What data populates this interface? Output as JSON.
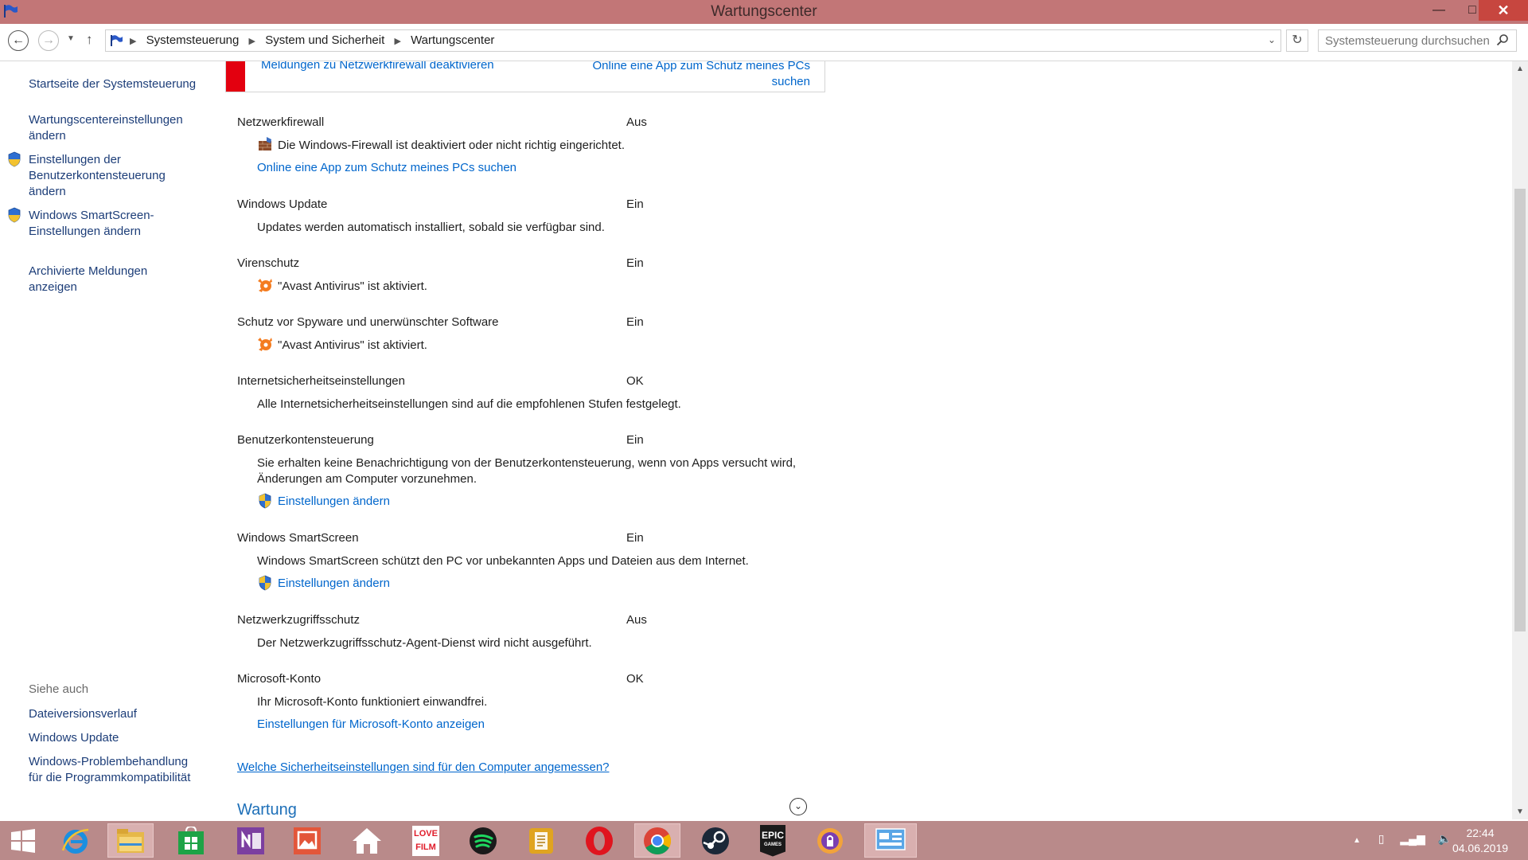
{
  "window": {
    "title": "Wartungscenter",
    "minimize": "—",
    "maximize": "□",
    "close": "✕"
  },
  "address": {
    "crumbs": [
      "Systemsteuerung",
      "System und Sicherheit",
      "Wartungscenter"
    ],
    "search_placeholder": "Systemsteuerung durchsuchen"
  },
  "sidebar": {
    "home": "Startseite der Systemsteuerung",
    "items": [
      "Wartungscentereinstellungen ändern",
      "Einstellungen der Benutzerkontensteuerung ändern",
      "Windows SmartScreen-Einstellungen ändern",
      "Archivierte Meldungen anzeigen"
    ],
    "see_also_label": "Siehe auch",
    "see_also": [
      "Dateiversionsverlauf",
      "Windows Update",
      "Windows-Problembehandlung für die Programmkompatibilität"
    ]
  },
  "banner": {
    "link1": "Meldungen zu Netzwerkfirewall deaktivieren",
    "link2": "Online eine App zum Schutz meines PCs suchen"
  },
  "rows": [
    {
      "title": "Netzwerkfirewall",
      "state": "Aus",
      "desc": "Die Windows-Firewall ist deaktiviert oder nicht richtig eingerichtet.",
      "link": "Online eine App zum Schutz meines PCs suchen"
    },
    {
      "title": "Windows Update",
      "state": "Ein",
      "desc": "Updates werden automatisch installiert, sobald sie verfügbar sind."
    },
    {
      "title": "Virenschutz",
      "state": "Ein",
      "desc": "\"Avast Antivirus\" ist aktiviert."
    },
    {
      "title": "Schutz vor Spyware und unerwünschter Software",
      "state": "Ein",
      "desc": "\"Avast Antivirus\" ist aktiviert."
    },
    {
      "title": "Internetsicherheitseinstellungen",
      "state": "OK",
      "desc": "Alle Internetsicherheitseinstellungen sind auf die empfohlenen Stufen festgelegt."
    },
    {
      "title": "Benutzerkontensteuerung",
      "state": "Ein",
      "desc_line1": "Sie erhalten keine Benachrichtigung von der Benutzerkontensteuerung, wenn von Apps versucht wird,",
      "desc_line2": "Änderungen am Computer vorzunehmen.",
      "link": "Einstellungen ändern"
    },
    {
      "title": "Windows SmartScreen",
      "state": "Ein",
      "desc": "Windows SmartScreen schützt den PC vor unbekannten Apps und Dateien aus dem Internet.",
      "link": "Einstellungen ändern"
    },
    {
      "title": "Netzwerkzugriffsschutz",
      "state": "Aus",
      "desc": "Der Netzwerkzugriffsschutz-Agent-Dienst wird nicht ausgeführt."
    },
    {
      "title": "Microsoft-Konto",
      "state": "OK",
      "desc": "Ihr Microsoft-Konto funktioniert einwandfrei.",
      "link": "Einstellungen für Microsoft-Konto anzeigen"
    }
  ],
  "bottom_link": "Welche Sicherheitseinstellungen sind für den Computer angemessen?",
  "section_title": "Wartung",
  "taskbar": {
    "apps": [
      "start-icon",
      "internet-explorer-icon",
      "file-explorer-icon",
      "store-icon",
      "onenote-icon",
      "photos-icon",
      "home-icon",
      "lovefilm-icon",
      "spotify-icon",
      "notes-icon",
      "opera-icon",
      "chrome-icon",
      "steam-icon",
      "epic-games-icon",
      "avast-secureline-icon",
      "control-panel-icon"
    ],
    "lovefilm_text": "LOVE FILM",
    "epic_text": "EPIC",
    "epic_sub": "GAMES",
    "time": "22:44",
    "date": "04.06.2019"
  },
  "colors": {
    "titlebar": "#c27677",
    "taskbar": "#b98a8a",
    "link": "#0066cc",
    "sidebar_link": "#1c3d78",
    "alert": "#e3000f",
    "section": "#1d6fb8"
  }
}
